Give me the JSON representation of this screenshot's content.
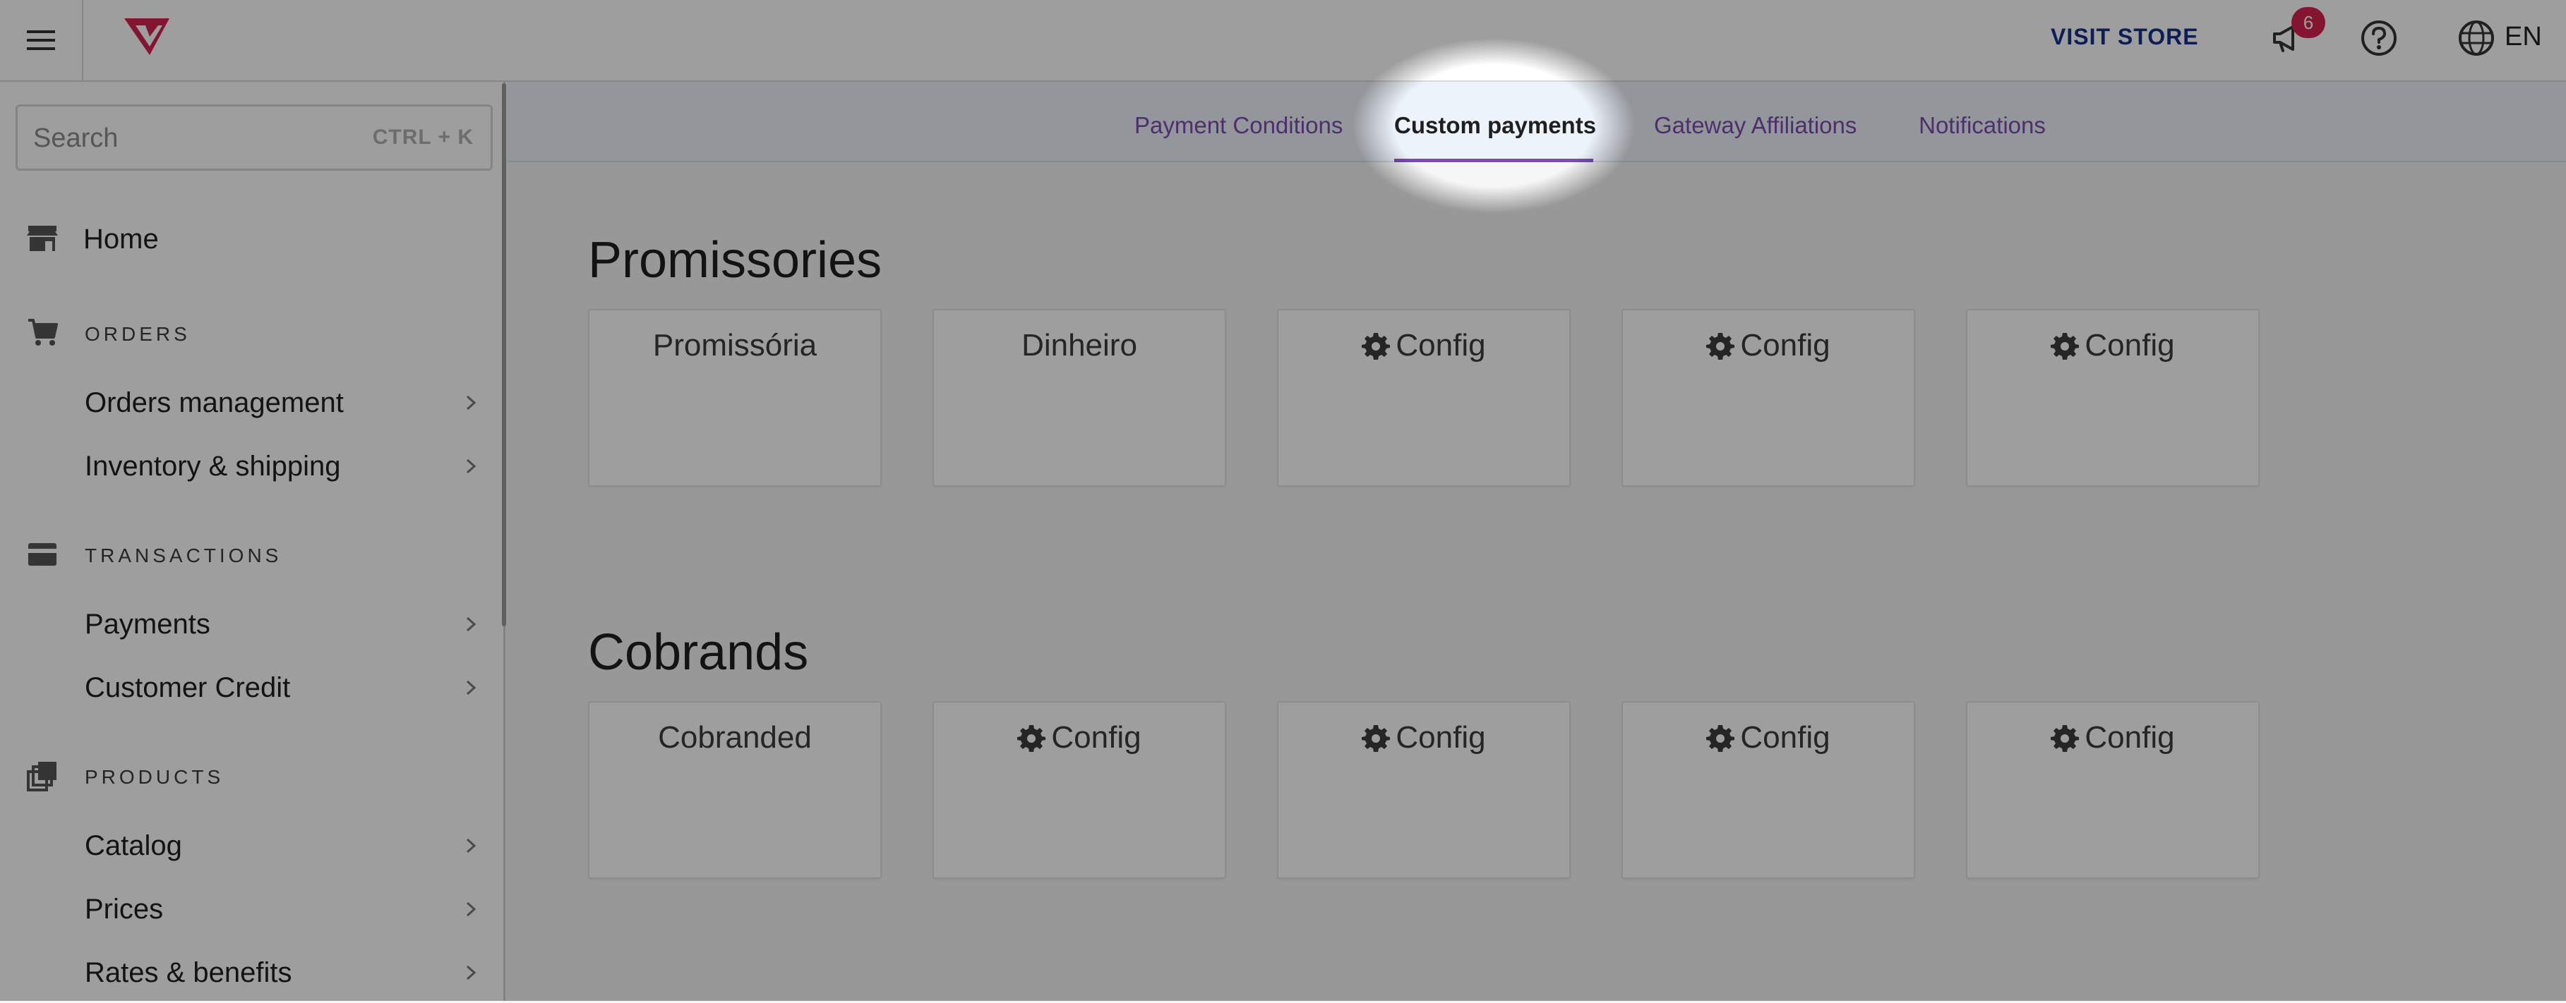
{
  "header": {
    "visit_store_label": "VISIT STORE",
    "notifications_count": "6",
    "language_label": "EN",
    "brand_color": "#d6204e",
    "link_color": "#142f8e"
  },
  "sidebar": {
    "search": {
      "placeholder": "Search",
      "shortcut": "CTRL + K"
    },
    "home_label": "Home",
    "sections": [
      {
        "label": "ORDERS",
        "icon": "cart-icon",
        "items": [
          {
            "label": "Orders management"
          },
          {
            "label": "Inventory & shipping"
          }
        ]
      },
      {
        "label": "TRANSACTIONS",
        "icon": "credit-card-icon",
        "items": [
          {
            "label": "Payments"
          },
          {
            "label": "Customer Credit"
          }
        ]
      },
      {
        "label": "PRODUCTS",
        "icon": "products-icon",
        "items": [
          {
            "label": "Catalog"
          },
          {
            "label": "Prices"
          },
          {
            "label": "Rates & benefits"
          }
        ]
      }
    ]
  },
  "tabs": [
    {
      "label": "Payment Conditions",
      "active": false
    },
    {
      "label": "Custom payments",
      "active": true
    },
    {
      "label": "Gateway Affiliations",
      "active": false
    },
    {
      "label": "Notifications",
      "active": false
    }
  ],
  "accent_color": "#7d4bb0",
  "promissories": {
    "title": "Promissories",
    "cards": [
      {
        "label": "Promissória",
        "icon": ""
      },
      {
        "label": "Dinheiro",
        "icon": ""
      },
      {
        "label": "Config",
        "icon": "gear-icon"
      },
      {
        "label": "Config",
        "icon": "gear-icon"
      },
      {
        "label": "Config",
        "icon": "gear-icon"
      }
    ]
  },
  "cobrands": {
    "title": "Cobrands",
    "cards": [
      {
        "label": "Cobranded",
        "icon": ""
      },
      {
        "label": "Config",
        "icon": "gear-icon"
      },
      {
        "label": "Config",
        "icon": "gear-icon"
      },
      {
        "label": "Config",
        "icon": "gear-icon"
      },
      {
        "label": "Config",
        "icon": "gear-icon"
      }
    ]
  }
}
